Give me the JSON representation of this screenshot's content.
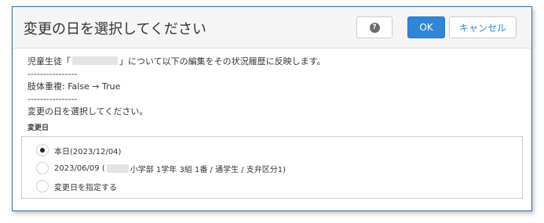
{
  "dialog": {
    "title": "変更の日を選択してください",
    "help_glyph": "?",
    "ok_label": "OK",
    "cancel_label": "キャンセル"
  },
  "message": {
    "line1_prefix": "児童生徒「",
    "line1_suffix": "」について以下の編集をその状況履歴に反映します。",
    "separator": "----------------",
    "change": "肢体重複: False → True",
    "instruction": "変更の日を選択してください。"
  },
  "change_date": {
    "label": "変更日",
    "options": [
      {
        "label": "本日(2023/12/04)",
        "checked": true
      },
      {
        "label_prefix": "2023/06/09 (",
        "label_suffix": " 小学部 1学年 3組 1番 / 通学生 / 支弁区分1)",
        "checked": false
      },
      {
        "label": "変更日を指定する",
        "checked": false
      }
    ]
  },
  "colors": {
    "accent": "#2f86d6",
    "border": "#2f6ea5"
  }
}
